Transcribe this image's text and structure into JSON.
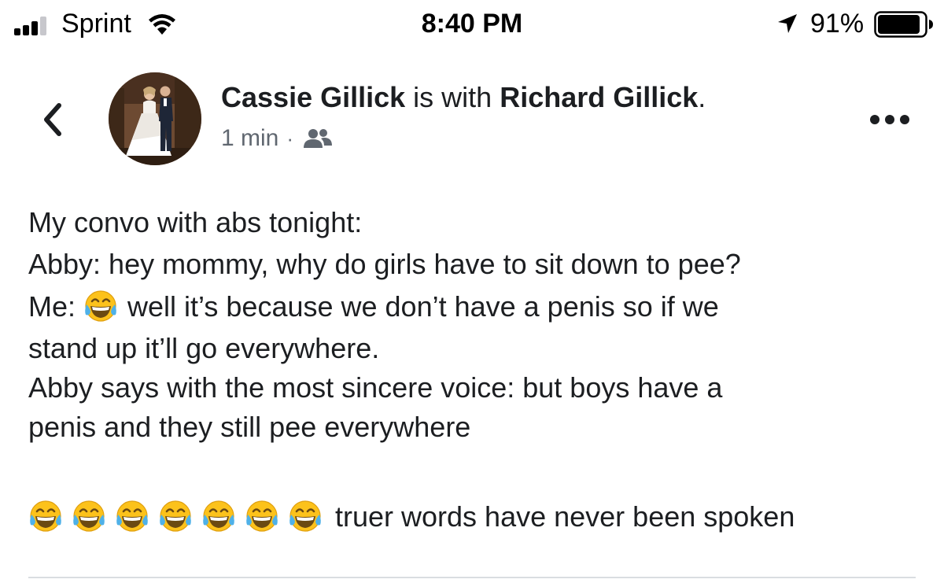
{
  "status_bar": {
    "carrier": "Sprint",
    "time": "8:40 PM",
    "battery_percent": "91%",
    "battery_level": 0.91,
    "icons": [
      "signal-icon",
      "wifi-icon",
      "location-arrow-icon",
      "battery-icon"
    ]
  },
  "post": {
    "author": "Cassie Gillick",
    "with_text": "is with",
    "tagged": "Richard Gillick",
    "period": ".",
    "timestamp": "1 min",
    "separator": "·",
    "audience_icon": "friends-icon",
    "body": {
      "line1": "My convo with abs tonight:",
      "line2": "Abby: hey mommy, why do girls have to sit down to pee?",
      "line3_prefix": "Me:",
      "line3_rest": "well it’s because we don’t have a penis so if we",
      "line4": "stand up it’ll go everywhere.",
      "line5": "Abby says with the most sincere voice: but boys have a",
      "line6": "penis and they still pee everywhere",
      "line7_text": "truer words have never been spoken"
    },
    "emoji": "tears-of-joy-emoji",
    "emoji_count": 7
  },
  "colors": {
    "text": "#1c1e21",
    "meta": "#606770",
    "divider": "#dadde1",
    "emoji_face": "#fcc21b",
    "emoji_tears": "#4fb1e8"
  }
}
